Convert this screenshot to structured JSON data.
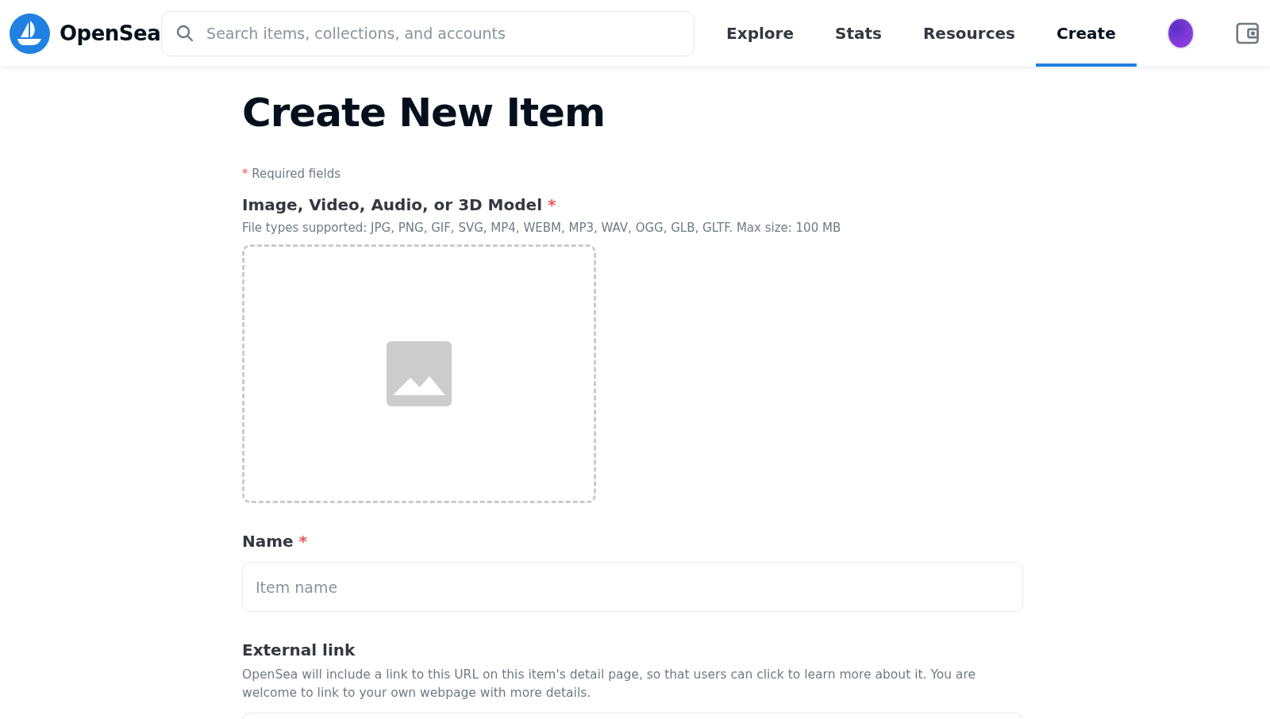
{
  "header": {
    "brand": "OpenSea",
    "search": {
      "placeholder": "Search items, collections, and accounts"
    },
    "nav": [
      {
        "label": "Explore",
        "selected": false
      },
      {
        "label": "Stats",
        "selected": false
      },
      {
        "label": "Resources",
        "selected": false
      },
      {
        "label": "Create",
        "selected": true
      }
    ]
  },
  "page": {
    "title": "Create New Item",
    "required_note": {
      "mark": "*",
      "text": "Required fields"
    },
    "media": {
      "label": "Image, Video, Audio, or 3D Model",
      "required": true,
      "hint": "File types supported: JPG, PNG, GIF, SVG, MP4, WEBM, MP3, WAV, OGG, GLB, GLTF. Max size: 100 MB"
    },
    "name": {
      "label": "Name",
      "required": true,
      "placeholder": "Item name"
    },
    "external_link": {
      "label": "External link",
      "required": false,
      "description": "OpenSea will include a link to this URL on this item's detail page, so that users can click to learn more about it. You are welcome to link to your own webpage with more details."
    }
  }
}
